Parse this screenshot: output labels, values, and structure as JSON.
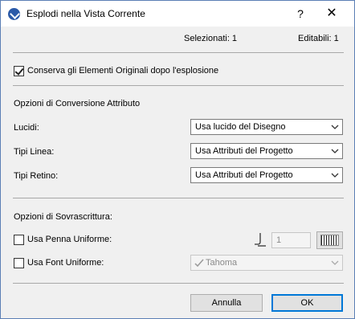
{
  "window": {
    "title": "Esplodi nella Vista Corrente",
    "help_label": "?",
    "close_label": "✕",
    "icon": "archicad-app-icon"
  },
  "status": {
    "selected": "Selezionati: 1",
    "editable": "Editabili: 1"
  },
  "keep_originals": {
    "label": "Conserva gli Elementi Originali dopo l'esplosione",
    "checked": true
  },
  "conversion": {
    "heading": "Opzioni di Conversione Attributo",
    "layers_label": "Lucidi:",
    "layers_value": "Usa lucido del Disegno",
    "linetypes_label": "Tipi Linea:",
    "linetypes_value": "Usa Attributi del Progetto",
    "fills_label": "Tipi Retino:",
    "fills_value": "Usa Attributi del Progetto"
  },
  "override": {
    "heading": "Opzioni di Sovrascrittura:",
    "pen_label": "Usa Penna Uniforme:",
    "pen_checked": false,
    "pen_value": "1",
    "font_label": "Usa Font Uniforme:",
    "font_checked": false,
    "font_value": "Tahoma"
  },
  "buttons": {
    "cancel": "Annulla",
    "ok": "OK"
  }
}
